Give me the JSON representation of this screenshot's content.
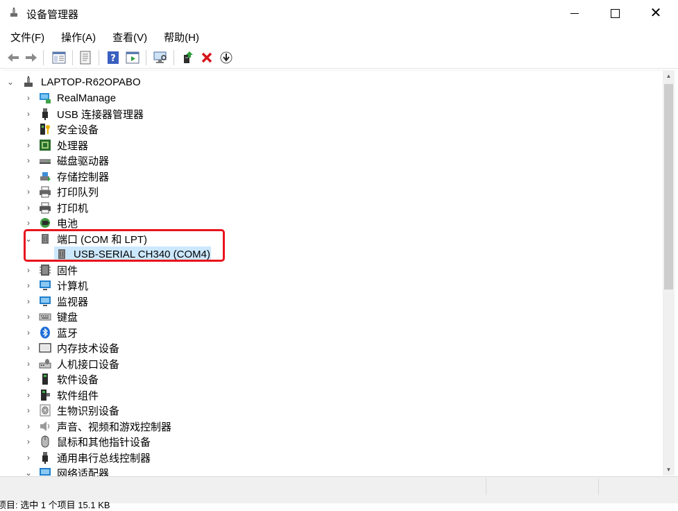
{
  "window": {
    "title": "设备管理器"
  },
  "menu": {
    "file": "文件(F)",
    "action": "操作(A)",
    "view": "查看(V)",
    "help": "帮助(H)"
  },
  "toolbar": {
    "buttons": [
      "back-arrow-icon",
      "forward-arrow-icon",
      "properties-icon",
      "driver-icon",
      "help-icon",
      "run-icon",
      "scan-monitor-icon",
      "update-driver-icon",
      "uninstall-x-icon",
      "download-icon"
    ]
  },
  "tree": {
    "root": "LAPTOP-R62OPABO",
    "items": [
      "RealManage",
      "USB 连接器管理器",
      "安全设备",
      "处理器",
      "磁盘驱动器",
      "存储控制器",
      "打印队列",
      "打印机",
      "电池",
      "端口 (COM 和 LPT)",
      "固件",
      "计算机",
      "监视器",
      "键盘",
      "蓝牙",
      "内存技术设备",
      "人机接口设备",
      "软件设备",
      "软件组件",
      "生物识别设备",
      "声音、视频和游戏控制器",
      "鼠标和其他指针设备",
      "通用串行总线控制器",
      "网络适配器"
    ],
    "expanded_child": "USB-SERIAL CH340 (COM4)"
  },
  "status": {
    "text": "项目: 选中 1 个项目 15.1 KB"
  },
  "colors": {
    "selection": "#cce8ff",
    "highlight": "#e8131c"
  }
}
